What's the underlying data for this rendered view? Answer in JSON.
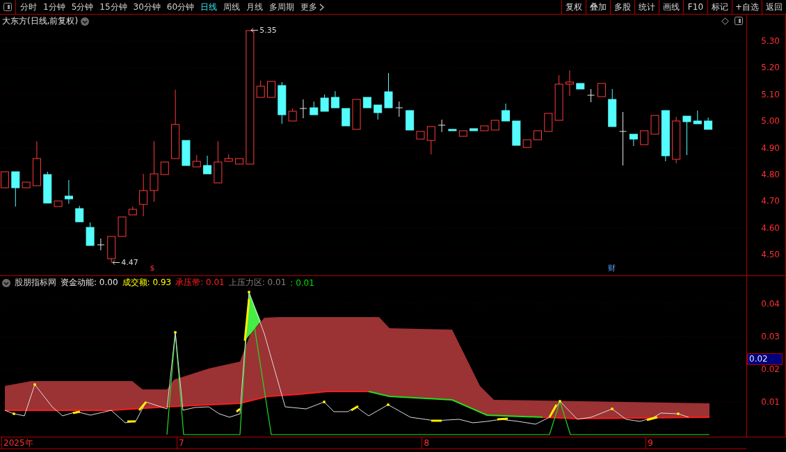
{
  "toolbar": {
    "periods": [
      {
        "label": "分时",
        "selected": false
      },
      {
        "label": "1分钟",
        "selected": false
      },
      {
        "label": "5分钟",
        "selected": false
      },
      {
        "label": "15分钟",
        "selected": false
      },
      {
        "label": "30分钟",
        "selected": false
      },
      {
        "label": "60分钟",
        "selected": false
      },
      {
        "label": "日线",
        "selected": true
      },
      {
        "label": "周线",
        "selected": false
      },
      {
        "label": "月线",
        "selected": false
      },
      {
        "label": "多周期",
        "selected": false
      }
    ],
    "more": "更多",
    "actions": [
      "复权",
      "叠加",
      "多股",
      "统计",
      "画线",
      "F10",
      "标记",
      "+自选",
      "返回"
    ]
  },
  "price_panel": {
    "title": "大东方(日线,前复权)",
    "high_label": "5.35",
    "low_label": "4.47",
    "event_marks": [
      "$",
      "财"
    ],
    "y_axis": [
      "5.30",
      "5.20",
      "5.10",
      "5.00",
      "4.90",
      "4.80",
      "4.70",
      "4.60",
      "4.50"
    ]
  },
  "indicator_panel": {
    "name": "股朋指标网",
    "legend": [
      {
        "label": "资金动能: 0.00",
        "color": "#e6e6e6"
      },
      {
        "label": "成交额: 0.93",
        "color": "#ffff00"
      },
      {
        "label": "承压带: 0.01",
        "color": "#ff2020"
      },
      {
        "label": "上压力区: 0.01",
        "color": "#808080"
      },
      {
        "label": ": 0.01",
        "color": "#00e000"
      }
    ],
    "y_axis": [
      "0.04",
      "0.03",
      "0.02",
      "0.01"
    ],
    "cursor_value": "0.02"
  },
  "date_axis": [
    "2025年",
    "7",
    "8",
    "9"
  ]
}
